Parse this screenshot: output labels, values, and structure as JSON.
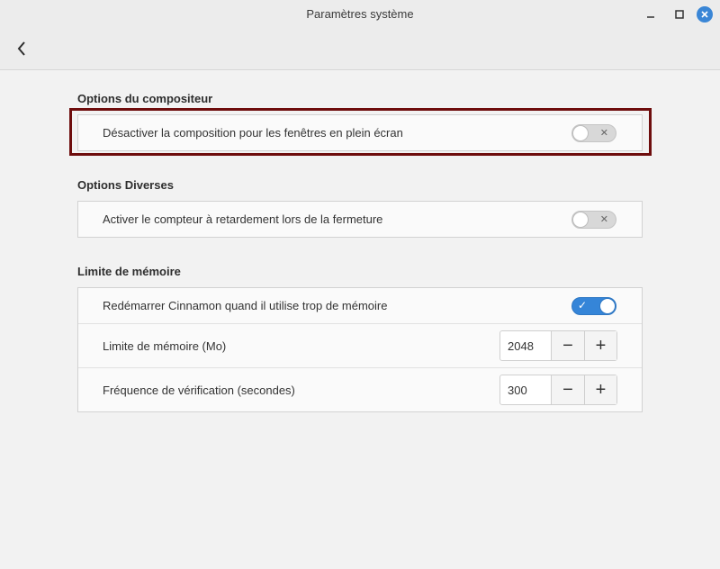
{
  "window": {
    "title": "Paramètres système",
    "minimize_glyph": "—",
    "maximize_glyph": "□",
    "close_glyph": "✕"
  },
  "header": {
    "back_icon": "chevron-left-icon"
  },
  "sections": {
    "compositor": {
      "title": "Options du compositeur",
      "rows": [
        {
          "label": "Désactiver la composition pour les fenêtres en plein écran",
          "toggle": false
        }
      ]
    },
    "misc": {
      "title": "Options Diverses",
      "rows": [
        {
          "label": "Activer le compteur à retardement lors de la fermeture",
          "toggle": false
        }
      ]
    },
    "memory": {
      "title": "Limite de mémoire",
      "restart": {
        "label": "Redémarrer Cinnamon quand il utilise trop de mémoire",
        "toggle": true
      },
      "limit": {
        "label": "Limite de mémoire (Mo)",
        "value": "2048"
      },
      "frequency": {
        "label": "Fréquence de vérification (secondes)",
        "value": "300"
      }
    }
  },
  "spin": {
    "minus": "−",
    "plus": "+"
  },
  "toggle_marks": {
    "off": "✕",
    "on": "✓"
  },
  "colors": {
    "accent": "#3585d8",
    "highlight_border": "#6e0d0d",
    "close_button": "#3a86d6"
  }
}
